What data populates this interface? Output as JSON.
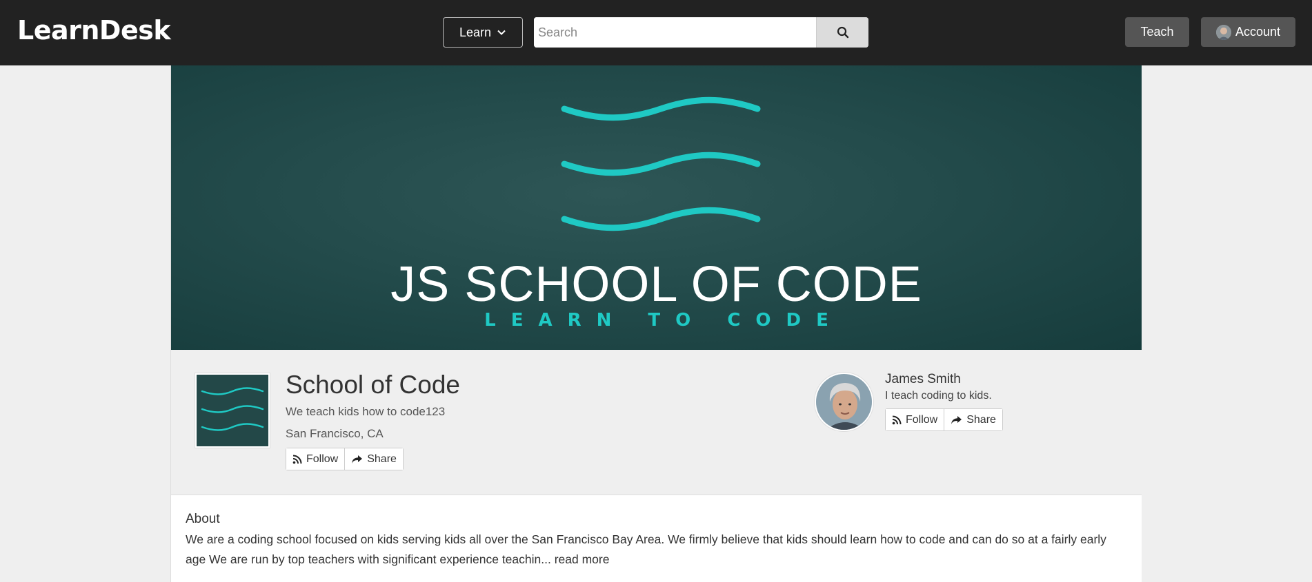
{
  "header": {
    "brand": "LearnDesk",
    "learn_label": "Learn",
    "search_placeholder": "Search",
    "teach_label": "Teach",
    "account_label": "Account"
  },
  "banner": {
    "title": "JS SCHOOL OF CODE",
    "subtitle": "LEARN TO CODE",
    "accent_color": "#1fc9c4",
    "background_color": "#234b4b"
  },
  "school": {
    "name": "School of Code",
    "tagline": "We teach kids how to code123",
    "location": "San Francisco, CA",
    "follow_label": "Follow",
    "share_label": "Share"
  },
  "instructor": {
    "name": "James Smith",
    "bio": "I teach coding to kids.",
    "follow_label": "Follow",
    "share_label": "Share"
  },
  "about": {
    "title": "About",
    "text": "We are a coding school focused on kids serving kids all over the San Francisco Bay Area. We firmly believe that kids should learn how to code and can do so at a fairly early age We are run by top teachers with significant experience teachin...",
    "read_more": "read more"
  },
  "icons": {
    "learn_dropdown": "chevron-down-icon",
    "search": "search-icon",
    "follow": "rss-icon",
    "share": "share-icon"
  }
}
